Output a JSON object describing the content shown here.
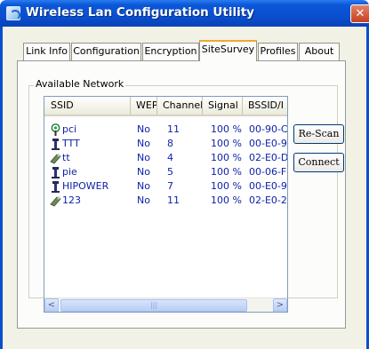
{
  "window": {
    "title": "Wireless Lan Configuration Utility",
    "close_glyph": "✕"
  },
  "tabs": [
    {
      "label": "Link Info"
    },
    {
      "label": "Configuration"
    },
    {
      "label": "Encryption"
    },
    {
      "label": "SiteSurvey",
      "active": true
    },
    {
      "label": "Profiles"
    },
    {
      "label": "About"
    }
  ],
  "group": {
    "label": "Available Network"
  },
  "table": {
    "columns": [
      "SSID",
      "WEP",
      "Channel",
      "Signal",
      "BSSID/I"
    ],
    "rows": [
      {
        "icon": "access-point-icon",
        "ssid": "pci",
        "wep": "No",
        "channel": "11",
        "signal": "100 %",
        "bssid": "00-90-C"
      },
      {
        "icon": "adhoc-station-icon",
        "ssid": "TTT",
        "wep": "No",
        "channel": "8",
        "signal": "100 %",
        "bssid": "00-E0-9"
      },
      {
        "icon": "wired-link-icon",
        "ssid": "tt",
        "wep": "No",
        "channel": "4",
        "signal": "100 %",
        "bssid": "02-E0-D"
      },
      {
        "icon": "adhoc-station-icon",
        "ssid": "pie",
        "wep": "No",
        "channel": "5",
        "signal": "100 %",
        "bssid": "00-06-F"
      },
      {
        "icon": "adhoc-station-icon",
        "ssid": "HIPOWER",
        "wep": "No",
        "channel": "7",
        "signal": "100 %",
        "bssid": "00-E0-9"
      },
      {
        "icon": "wired-link-icon",
        "ssid": "123",
        "wep": "No",
        "channel": "11",
        "signal": "100 %",
        "bssid": "02-E0-2"
      }
    ]
  },
  "scrollbar": {
    "left_glyph": "<",
    "right_glyph": ">",
    "grip": "|||"
  },
  "buttons": {
    "rescan": "Re-Scan",
    "connect": "Connect"
  },
  "colors": {
    "titlebar": "#0a4fd0",
    "link_text": "#0b1fa8",
    "active_tab_accent": "#f0a830"
  }
}
